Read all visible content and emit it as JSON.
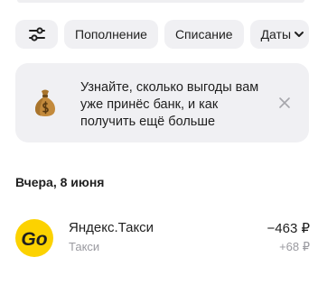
{
  "filters": {
    "settings_icon": "sliders-icon",
    "chips": [
      "Пополнение",
      "Списание"
    ],
    "dates_label": "Даты",
    "dates_icon": "chevron-down-icon"
  },
  "promo": {
    "icon": "money-bag-icon",
    "text": "Узнайте, сколько выгоды вам уже принёс банк, и как получить ещё больше",
    "close_icon": "close-icon"
  },
  "date_header": "Вчера, 8 июня",
  "transactions": [
    {
      "logo_text": "Go",
      "name": "Яндекс.Такси",
      "category": "Такси",
      "amount": "−463 ₽",
      "cashback": "+68 ₽"
    }
  ],
  "colors": {
    "chip_bg": "#f0f0f3",
    "logo_bg": "#fcd200",
    "secondary_text": "#9a9aa0"
  }
}
